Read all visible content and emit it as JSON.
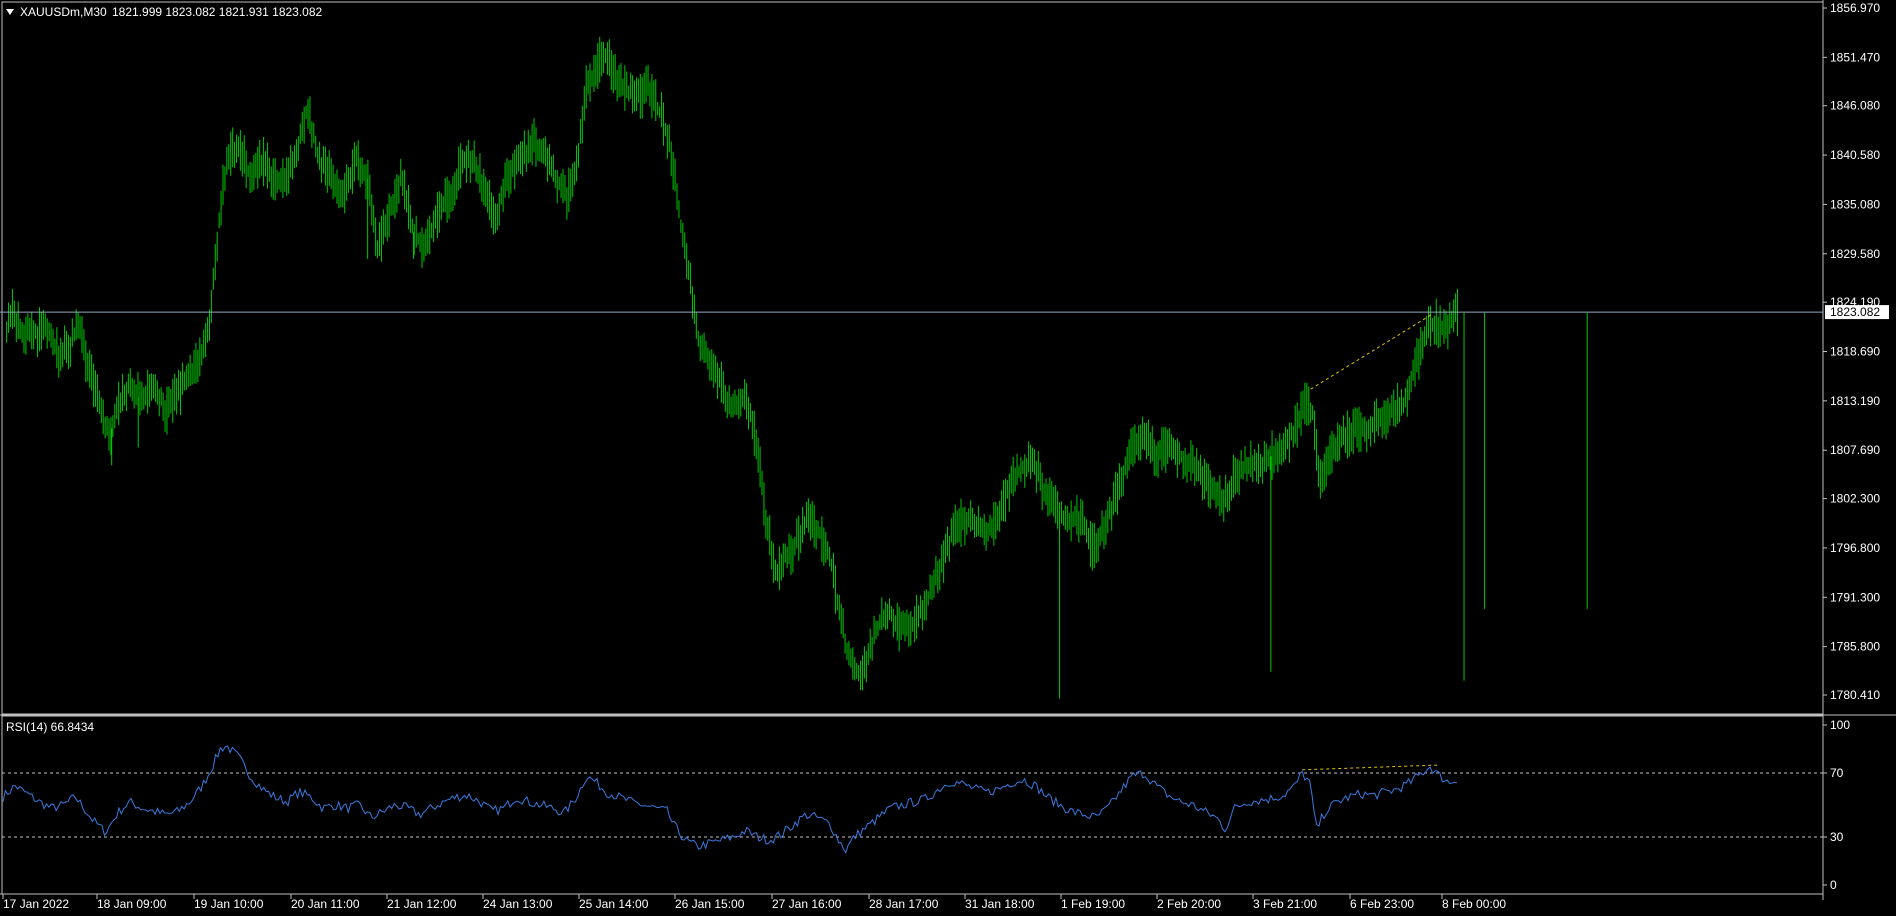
{
  "header": {
    "menu_icon": "triangle-down-icon",
    "symbol": "XAUUSDm,M30",
    "ohlc": "1821.999 1823.082 1821.931 1823.082"
  },
  "rsi_header": "RSI(14) 66.8434",
  "colors": {
    "background": "#000000",
    "candles": "#00c800",
    "rsi_line": "#3a7be0",
    "trendline": "#e0c000",
    "grid_axis": "#c0c0c0",
    "level_line": "#c0c0c0",
    "price_marker_bg": "#ffffff",
    "price_marker_text": "#000000"
  },
  "chart_data": [
    {
      "type": "candlestick",
      "symbol": "XAUUSDm",
      "timeframe": "M30",
      "last_price": "1823.082",
      "y_ticks": [
        "1856.970",
        "1851.470",
        "1846.080",
        "1840.580",
        "1835.080",
        "1829.580",
        "1824.190",
        "1818.690",
        "1813.190",
        "1807.690",
        "1802.300",
        "1796.800",
        "1791.300",
        "1785.800",
        "1780.410"
      ],
      "ylim": [
        1780.41,
        1856.97
      ],
      "x_ticks": [
        "17 Jan 2022",
        "18 Jan 09:00",
        "19 Jan 10:00",
        "20 Jan 11:00",
        "21 Jan 12:00",
        "24 Jan 13:00",
        "25 Jan 14:00",
        "26 Jan 15:00",
        "27 Jan 16:00",
        "28 Jan 17:00",
        "31 Jan 18:00",
        "1 Feb 19:00",
        "2 Feb 20:00",
        "3 Feb 21:00",
        "6 Feb 23:00",
        "8 Feb 00:00"
      ],
      "price_path": [
        [
          0,
          1820.5
        ],
        [
          8,
          1823
        ],
        [
          15,
          1821
        ],
        [
          25,
          1820.5
        ],
        [
          35,
          1821.5
        ],
        [
          45,
          1818.5
        ],
        [
          55,
          1819
        ],
        [
          62,
          1822
        ],
        [
          70,
          1817
        ],
        [
          80,
          1813
        ],
        [
          88,
          1809
        ],
        [
          95,
          1813
        ],
        [
          105,
          1815
        ],
        [
          115,
          1813
        ],
        [
          125,
          1815
        ],
        [
          135,
          1812
        ],
        [
          145,
          1814
        ],
        [
          155,
          1816
        ],
        [
          165,
          1818
        ],
        [
          172,
          1823
        ],
        [
          178,
          1832
        ],
        [
          185,
          1840
        ],
        [
          195,
          1842
        ],
        [
          205,
          1838
        ],
        [
          215,
          1840
        ],
        [
          225,
          1838
        ],
        [
          235,
          1838
        ],
        [
          245,
          1842
        ],
        [
          252,
          1846
        ],
        [
          262,
          1840
        ],
        [
          272,
          1838
        ],
        [
          282,
          1836
        ],
        [
          292,
          1840
        ],
        [
          302,
          1838
        ],
        [
          310,
          1830
        ],
        [
          320,
          1834
        ],
        [
          330,
          1838
        ],
        [
          340,
          1832
        ],
        [
          350,
          1830
        ],
        [
          360,
          1834
        ],
        [
          370,
          1836
        ],
        [
          380,
          1840
        ],
        [
          390,
          1840
        ],
        [
          400,
          1836
        ],
        [
          408,
          1834
        ],
        [
          418,
          1838
        ],
        [
          428,
          1840
        ],
        [
          440,
          1842
        ],
        [
          450,
          1840
        ],
        [
          458,
          1838
        ],
        [
          467,
          1836
        ],
        [
          476,
          1840
        ],
        [
          483,
          1848
        ],
        [
          490,
          1850
        ],
        [
          497,
          1852
        ],
        [
          505,
          1850
        ],
        [
          515,
          1848
        ],
        [
          525,
          1847
        ],
        [
          535,
          1848
        ],
        [
          545,
          1845
        ],
        [
          552,
          1842
        ],
        [
          558,
          1836
        ],
        [
          564,
          1830
        ],
        [
          570,
          1826
        ],
        [
          576,
          1820
        ],
        [
          585,
          1818
        ],
        [
          595,
          1815
        ],
        [
          605,
          1812
        ],
        [
          615,
          1814
        ],
        [
          625,
          1808
        ],
        [
          632,
          1800
        ],
        [
          640,
          1794
        ],
        [
          648,
          1796
        ],
        [
          656,
          1797
        ],
        [
          665,
          1800
        ],
        [
          675,
          1799
        ],
        [
          685,
          1796
        ],
        [
          692,
          1790
        ],
        [
          700,
          1785
        ],
        [
          708,
          1783
        ],
        [
          715,
          1784
        ],
        [
          722,
          1787
        ],
        [
          732,
          1790
        ],
        [
          742,
          1788
        ],
        [
          752,
          1788
        ],
        [
          762,
          1790
        ],
        [
          772,
          1793
        ],
        [
          780,
          1796
        ],
        [
          788,
          1799
        ],
        [
          798,
          1800
        ],
        [
          808,
          1799
        ],
        [
          818,
          1799
        ],
        [
          826,
          1801
        ],
        [
          835,
          1804
        ],
        [
          845,
          1806
        ],
        [
          855,
          1806
        ],
        [
          862,
          1803
        ],
        [
          872,
          1801
        ],
        [
          882,
          1800
        ],
        [
          892,
          1800
        ],
        [
          902,
          1797
        ],
        [
          912,
          1799
        ],
        [
          920,
          1802
        ],
        [
          928,
          1805
        ],
        [
          936,
          1808
        ],
        [
          945,
          1809
        ],
        [
          955,
          1807
        ],
        [
          965,
          1808
        ],
        [
          975,
          1807
        ],
        [
          985,
          1806
        ],
        [
          995,
          1804
        ],
        [
          1005,
          1803
        ],
        [
          1012,
          1802
        ],
        [
          1020,
          1805
        ],
        [
          1030,
          1806
        ],
        [
          1040,
          1806
        ],
        [
          1050,
          1807
        ],
        [
          1060,
          1808
        ],
        [
          1070,
          1810
        ],
        [
          1078,
          1813
        ],
        [
          1085,
          1812
        ],
        [
          1090,
          1804
        ],
        [
          1100,
          1807
        ],
        [
          1110,
          1809
        ],
        [
          1120,
          1810
        ],
        [
          1130,
          1810
        ],
        [
          1140,
          1811
        ],
        [
          1150,
          1812
        ],
        [
          1160,
          1813
        ],
        [
          1170,
          1817
        ],
        [
          1178,
          1821
        ],
        [
          1186,
          1822
        ],
        [
          1195,
          1821
        ],
        [
          1205,
          1823
        ]
      ],
      "annotations": [
        {
          "type": "trendline",
          "from": [
            1083,
            1814.5
          ],
          "to": [
            1183,
            1822.8
          ],
          "style": "dashed"
        },
        {
          "type": "hline",
          "value": 1823.082,
          "label": "1823.082"
        }
      ]
    },
    {
      "type": "line",
      "name": "RSI(14)",
      "value": "66.8434",
      "ylim": [
        0,
        100
      ],
      "y_ticks": [
        "100",
        "70",
        "30",
        "0"
      ],
      "levels": [
        70,
        30
      ],
      "series_path": [
        [
          0,
          55
        ],
        [
          10,
          62
        ],
        [
          20,
          57
        ],
        [
          30,
          52
        ],
        [
          40,
          48
        ],
        [
          50,
          50
        ],
        [
          60,
          55
        ],
        [
          68,
          47
        ],
        [
          75,
          40
        ],
        [
          85,
          33
        ],
        [
          95,
          45
        ],
        [
          105,
          52
        ],
        [
          115,
          48
        ],
        [
          125,
          46
        ],
        [
          135,
          44
        ],
        [
          145,
          46
        ],
        [
          155,
          52
        ],
        [
          165,
          62
        ],
        [
          172,
          72
        ],
        [
          180,
          85
        ],
        [
          185,
          87
        ],
        [
          195,
          80
        ],
        [
          205,
          68
        ],
        [
          215,
          60
        ],
        [
          225,
          55
        ],
        [
          235,
          52
        ],
        [
          245,
          58
        ],
        [
          255,
          55
        ],
        [
          265,
          48
        ],
        [
          275,
          50
        ],
        [
          285,
          48
        ],
        [
          295,
          50
        ],
        [
          305,
          42
        ],
        [
          315,
          46
        ],
        [
          325,
          50
        ],
        [
          335,
          48
        ],
        [
          345,
          44
        ],
        [
          355,
          48
        ],
        [
          365,
          52
        ],
        [
          375,
          55
        ],
        [
          385,
          56
        ],
        [
          395,
          52
        ],
        [
          405,
          46
        ],
        [
          415,
          48
        ],
        [
          425,
          55
        ],
        [
          435,
          52
        ],
        [
          445,
          50
        ],
        [
          455,
          48
        ],
        [
          465,
          45
        ],
        [
          475,
          55
        ],
        [
          483,
          68
        ],
        [
          490,
          65
        ],
        [
          500,
          58
        ],
        [
          510,
          55
        ],
        [
          520,
          52
        ],
        [
          530,
          50
        ],
        [
          540,
          48
        ],
        [
          550,
          46
        ],
        [
          555,
          38
        ],
        [
          565,
          28
        ],
        [
          575,
          24
        ],
        [
          585,
          26
        ],
        [
          595,
          28
        ],
        [
          605,
          30
        ],
        [
          615,
          34
        ],
        [
          625,
          30
        ],
        [
          635,
          28
        ],
        [
          645,
          32
        ],
        [
          655,
          38
        ],
        [
          665,
          44
        ],
        [
          675,
          42
        ],
        [
          685,
          38
        ],
        [
          692,
          28
        ],
        [
          698,
          22
        ],
        [
          705,
          30
        ],
        [
          715,
          36
        ],
        [
          725,
          42
        ],
        [
          735,
          48
        ],
        [
          745,
          50
        ],
        [
          755,
          52
        ],
        [
          765,
          54
        ],
        [
          775,
          60
        ],
        [
          785,
          65
        ],
        [
          795,
          63
        ],
        [
          805,
          60
        ],
        [
          815,
          58
        ],
        [
          825,
          60
        ],
        [
          835,
          64
        ],
        [
          845,
          66
        ],
        [
          855,
          62
        ],
        [
          865,
          55
        ],
        [
          875,
          50
        ],
        [
          885,
          46
        ],
        [
          895,
          44
        ],
        [
          905,
          42
        ],
        [
          915,
          48
        ],
        [
          925,
          58
        ],
        [
          935,
          68
        ],
        [
          945,
          70
        ],
        [
          955,
          62
        ],
        [
          965,
          56
        ],
        [
          975,
          52
        ],
        [
          985,
          50
        ],
        [
          995,
          46
        ],
        [
          1005,
          42
        ],
        [
          1012,
          35
        ],
        [
          1020,
          48
        ],
        [
          1030,
          52
        ],
        [
          1040,
          53
        ],
        [
          1050,
          54
        ],
        [
          1060,
          56
        ],
        [
          1070,
          62
        ],
        [
          1076,
          70
        ],
        [
          1082,
          64
        ],
        [
          1088,
          35
        ],
        [
          1095,
          46
        ],
        [
          1105,
          52
        ],
        [
          1115,
          55
        ],
        [
          1125,
          57
        ],
        [
          1135,
          56
        ],
        [
          1145,
          58
        ],
        [
          1155,
          60
        ],
        [
          1165,
          64
        ],
        [
          1175,
          70
        ],
        [
          1182,
          74
        ],
        [
          1190,
          68
        ],
        [
          1198,
          64
        ],
        [
          1205,
          66.8
        ]
      ],
      "annotations": [
        {
          "type": "trendline",
          "from": [
            1076,
            72
          ],
          "to": [
            1190,
            75
          ],
          "style": "dashed"
        }
      ]
    }
  ]
}
